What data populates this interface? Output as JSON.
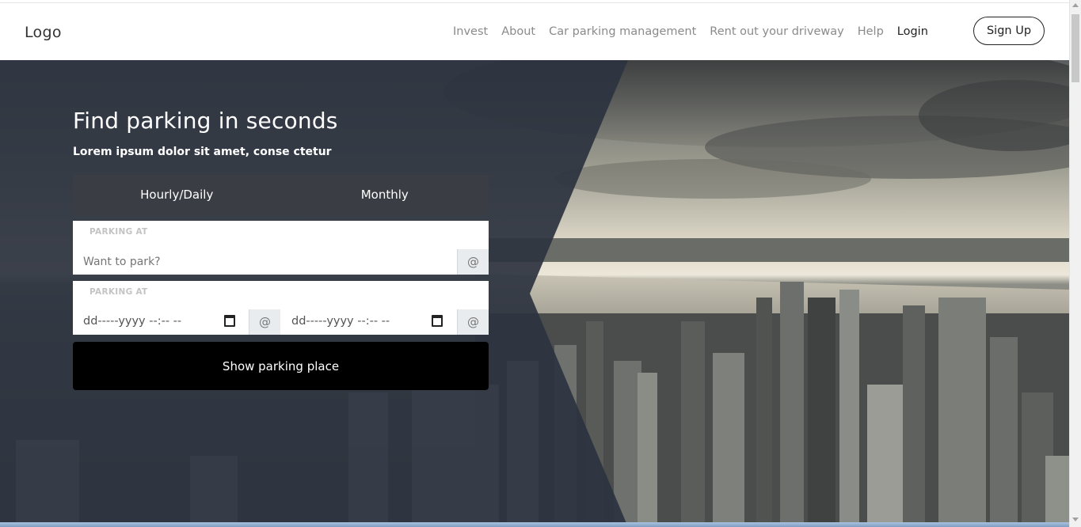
{
  "header": {
    "logo": "Logo",
    "nav": [
      "Invest",
      "About",
      "Car parking management",
      "Rent out your driveway",
      "Help"
    ],
    "login": "Login",
    "signup": "Sign Up"
  },
  "hero": {
    "title": "Find parking in seconds",
    "subtitle": "Lorem ipsum dolor sit amet, conse ctetur",
    "tabs": [
      "Hourly/Daily",
      "Monthly"
    ],
    "location_field": {
      "label": "PARKING AT",
      "placeholder": "Want to park?",
      "addon": "@"
    },
    "datetime_field": {
      "label": "PARKING AT",
      "start_value": "dd-----yyyy --:-- --",
      "end_value": "dd-----yyyy --:-- --",
      "addon": "@"
    },
    "submit": "Show parking place"
  },
  "colors": {
    "overlay": "#2d3440",
    "tabs_bg": "#3a3d44",
    "button_bg": "#000000"
  }
}
